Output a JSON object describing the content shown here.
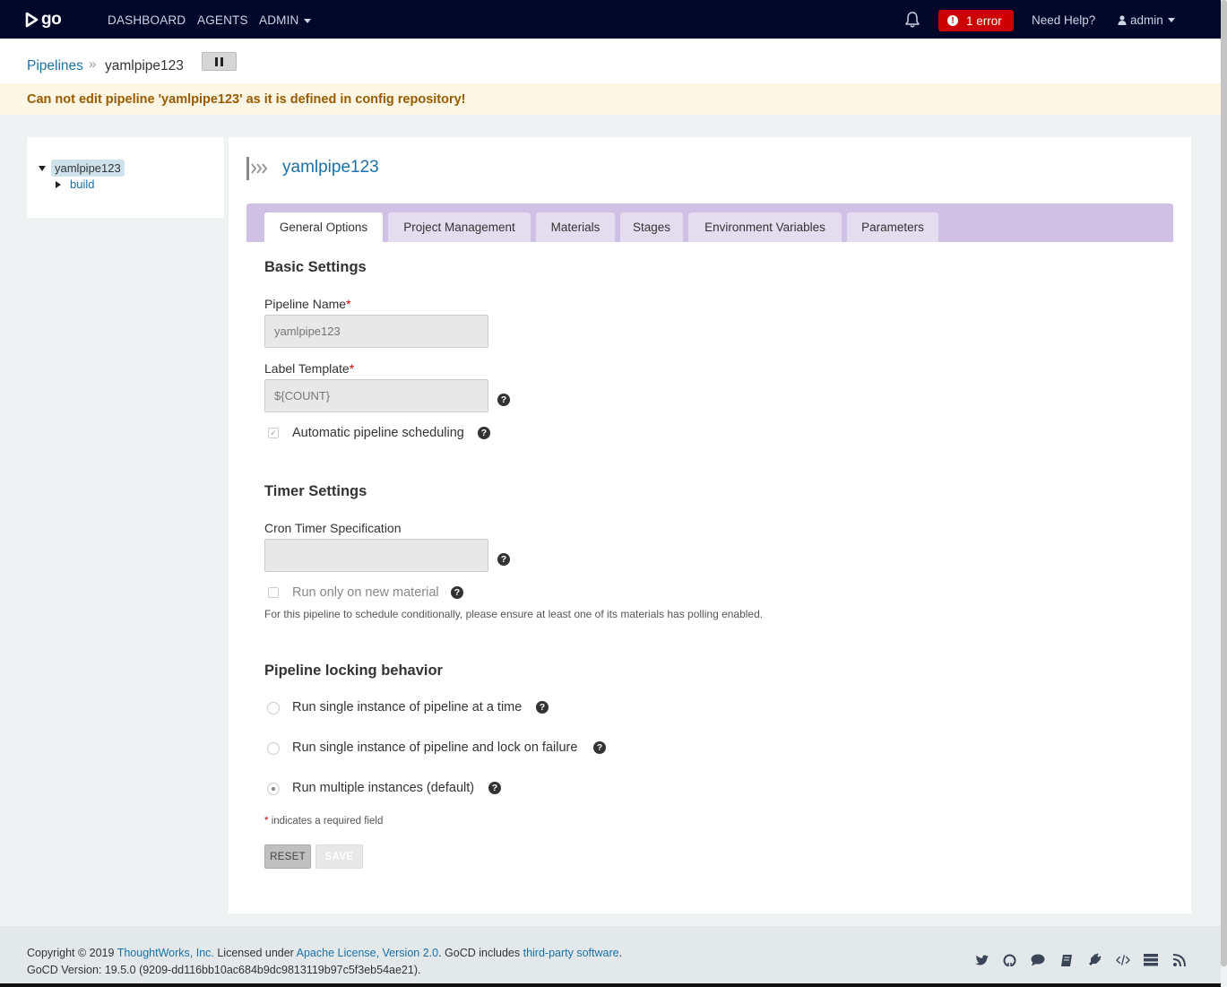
{
  "nav": {
    "logo_text": "go",
    "links": [
      "DASHBOARD",
      "AGENTS",
      "ADMIN"
    ],
    "error_badge": "1 error",
    "help": "Need Help?",
    "user": "admin"
  },
  "breadcrumb": {
    "root": "Pipelines",
    "separator": "»",
    "current": "yamlpipe123"
  },
  "flash": {
    "message": "Can not edit pipeline 'yamlpipe123' as it is defined in config repository!"
  },
  "tree": {
    "root": "yamlpipe123",
    "child": "build"
  },
  "main": {
    "title": "yamlpipe123",
    "tabs": [
      "General Options",
      "Project Management",
      "Materials",
      "Stages",
      "Environment Variables",
      "Parameters"
    ],
    "active_tab": "General Options",
    "basic": {
      "title": "Basic Settings",
      "pipeline_name_label": "Pipeline Name",
      "pipeline_name_value": "yamlpipe123",
      "label_template_label": "Label Template",
      "label_template_value": "${COUNT}",
      "auto_schedule_label": "Automatic pipeline scheduling",
      "auto_schedule_checked": true
    },
    "timer": {
      "title": "Timer Settings",
      "cron_label": "Cron Timer Specification",
      "cron_value": "",
      "run_new_material_label": "Run only on new material",
      "hint": "For this pipeline to schedule conditionally, please ensure at least one of its materials has polling enabled."
    },
    "locking": {
      "title": "Pipeline locking behavior",
      "options": [
        "Run single instance of pipeline at a time",
        "Run single instance of pipeline and lock on failure",
        "Run multiple instances (default)"
      ],
      "selected_index": 2
    },
    "required_note": "indicates a required field",
    "required_star": "*",
    "reset_label": "RESET",
    "save_label": "SAVE"
  },
  "footer": {
    "copyright": "Copyright © 2019",
    "company": "ThoughtWorks, Inc.",
    "licensed": "Licensed under",
    "license": "Apache License, Version 2.0",
    "includes": ". GoCD includes",
    "third_party": "third-party software",
    "period": ".",
    "version": "GoCD Version: 19.5.0 (9209-dd116bb10ac684b9dc9813119b97c5f3eb54ae21).",
    "icons": [
      "twitter-icon",
      "github-icon",
      "chat-icon",
      "docs-icon",
      "plugins-icon",
      "api-icon",
      "server-details-icon",
      "rss-icon"
    ]
  },
  "colors": {
    "nav_bg": "#000728",
    "link": "#1a71a8",
    "error": "#cc0000",
    "tabs_bg": "#cfc1e6",
    "flash_bg": "#fcf6e4"
  }
}
